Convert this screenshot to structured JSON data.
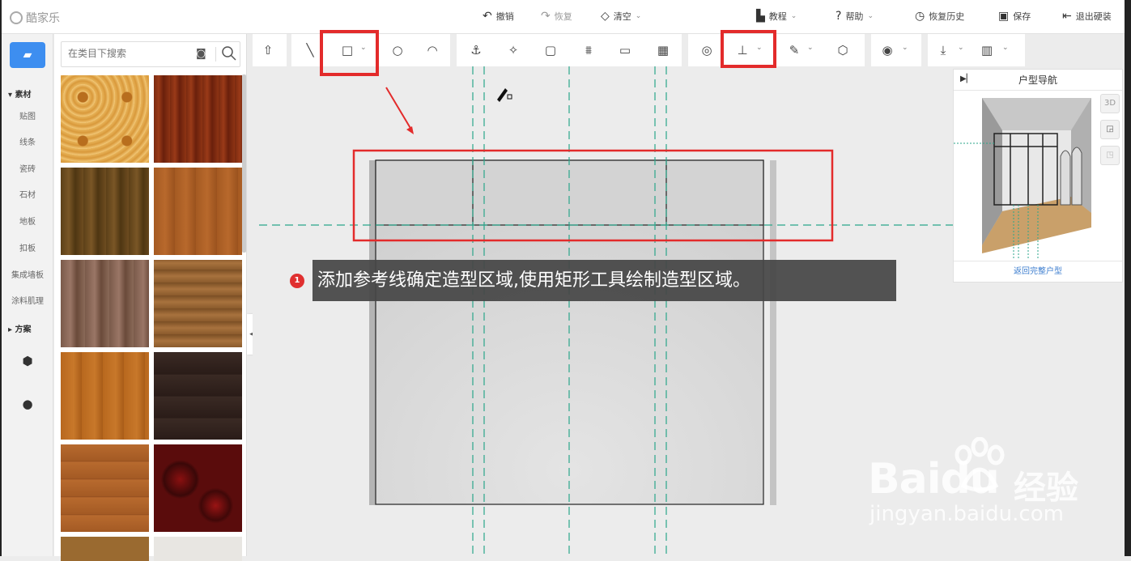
{
  "app": {
    "logo_text": "酷家乐"
  },
  "topbar": {
    "undo": "撤销",
    "redo": "恢复",
    "clear": "清空",
    "tutorial": "教程",
    "help": "帮助",
    "history": "恢复历史",
    "save": "保存",
    "exit": "退出硬装"
  },
  "rail": {
    "section_material": "素材",
    "items": [
      "贴图",
      "线条",
      "瓷砖",
      "石材",
      "地板",
      "扣板",
      "集成墙板",
      "涂料肌理"
    ],
    "section_plan": "方案"
  },
  "search": {
    "placeholder": "在类目下搜索"
  },
  "navigator": {
    "title": "户型导航",
    "view_3d": "3D",
    "back_link": "返回完整户型"
  },
  "annotation": {
    "step": "1",
    "text": "添加参考线确定造型区域,使用矩形工具绘制造型区域。"
  },
  "watermark": {
    "brand": "Bai",
    "brand2": "du",
    "cn": "经验",
    "url": "jingyan.baidu.com"
  },
  "colors": {
    "accent": "#3d8ef0",
    "highlight": "#e32b2b",
    "guide": "#2aa68a",
    "link": "#3d7ecf"
  },
  "icons": [
    "upload-icon",
    "line-icon",
    "rectangle-icon",
    "circle-icon",
    "arc-icon",
    "anchor-icon",
    "magic-icon",
    "frame-icon",
    "grid-lines-icon",
    "panel-icon",
    "pattern-icon",
    "target-icon",
    "guideline-icon",
    "brush-icon",
    "cube-icon",
    "eye-icon",
    "download-icon",
    "map-icon"
  ]
}
